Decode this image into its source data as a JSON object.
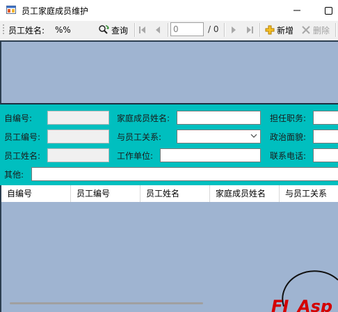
{
  "window": {
    "title": "员工家庭成员维护",
    "minimize_glyph": "—",
    "maximize_glyph": "☐"
  },
  "toolbar": {
    "search_label": "员工姓名:",
    "search_value": "%%",
    "query_label": "查询",
    "page_value": "0",
    "page_total": "/ 0",
    "add_label": "新增",
    "delete_label": "删除"
  },
  "form": {
    "id_label": "自编号:",
    "emp_no_label": "员工编号:",
    "emp_name_label": "员工姓名:",
    "member_name_label": "家庭成员姓名:",
    "relation_label": "与员工关系:",
    "work_unit_label": "工作单位:",
    "duty_label": "担任职务:",
    "politics_label": "政治面貌:",
    "phone_label": "联系电话:",
    "other_label": "其他:",
    "id_value": "",
    "emp_no_value": "",
    "emp_name_value": "",
    "member_name_value": "",
    "relation_value": "",
    "work_unit_value": "",
    "duty_value": "",
    "politics_value": "",
    "phone_value": "",
    "other_value": ""
  },
  "grid": {
    "columns": [
      "自编号",
      "员工编号",
      "员工姓名",
      "家庭成员姓名",
      "与员工关系"
    ]
  },
  "icons": {
    "app": "app-window-icon",
    "query": "magnifier-refresh-icon",
    "first": "first-page-icon",
    "prev": "prev-page-icon",
    "next": "next-page-icon",
    "last": "last-page-icon",
    "add": "plus-icon",
    "delete": "x-icon"
  },
  "colors": {
    "form_bg": "#00bfbf",
    "panel_bg": "#9fb4d1",
    "add_icon": "#e0a800"
  }
}
